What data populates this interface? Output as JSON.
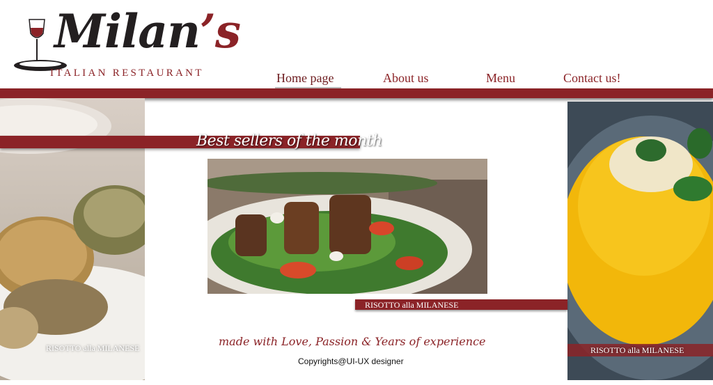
{
  "logo": {
    "name_main": "Milan",
    "name_apos": "’s",
    "subtitle": "ITALIAN RESTAURANT"
  },
  "nav": {
    "items": [
      {
        "label": "Home page"
      },
      {
        "label": "About us"
      },
      {
        "label": "Menu"
      },
      {
        "label": "Contact us!"
      }
    ]
  },
  "banner": {
    "title": "Best sellers of the month"
  },
  "main_dish": {
    "caption": "RISOTTO alla MILANESE"
  },
  "side_left": {
    "caption": "RISOTTO alla MILANESE"
  },
  "side_right": {
    "caption": "RISOTTO alla MILANESE"
  },
  "footer": {
    "tagline": "made with Love, Passion & Years of experience",
    "copyright": "Copyrights@UI-UX designer"
  },
  "colors": {
    "accent": "#8b2327",
    "text_dark": "#231f20"
  }
}
